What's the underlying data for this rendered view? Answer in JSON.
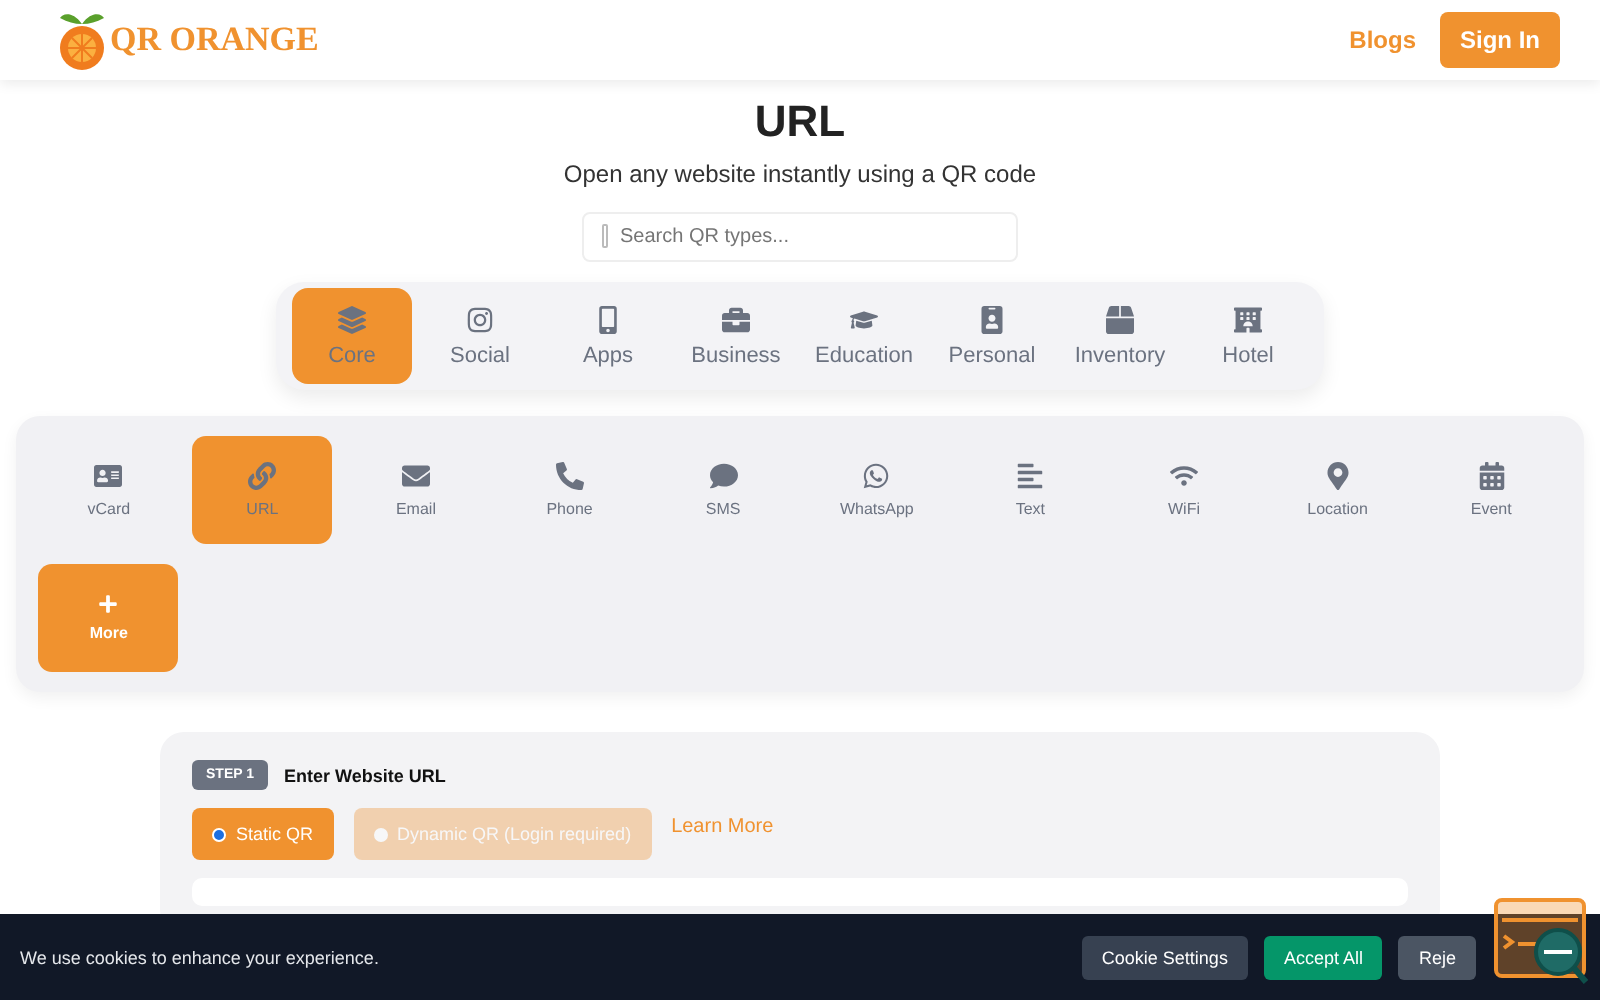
{
  "header": {
    "logo": "QR ORANGE",
    "nav": [
      {
        "label": "Blogs",
        "kind": "link"
      },
      {
        "label": "Sign In",
        "kind": "button"
      }
    ]
  },
  "title": "URL",
  "subtitle": "Open any website instantly using a QR code",
  "search": {
    "placeholder": "Search QR types..."
  },
  "categories": [
    {
      "label": "Core",
      "selected": true
    },
    {
      "label": "Social",
      "selected": false
    },
    {
      "label": "Apps",
      "selected": false
    },
    {
      "label": "Business",
      "selected": false
    },
    {
      "label": "Education",
      "selected": false
    },
    {
      "label": "Personal",
      "selected": false
    },
    {
      "label": "Inventory",
      "selected": false
    },
    {
      "label": "Hotel",
      "selected": false
    }
  ],
  "types": [
    {
      "label": "vCard",
      "kind": "type",
      "selected": false
    },
    {
      "label": "URL",
      "kind": "type",
      "selected": true
    },
    {
      "label": "Email",
      "kind": "type",
      "selected": false
    },
    {
      "label": "Phone",
      "kind": "type",
      "selected": false
    },
    {
      "label": "SMS",
      "kind": "type",
      "selected": false
    },
    {
      "label": "WhatsApp",
      "kind": "type",
      "selected": false
    },
    {
      "label": "Text",
      "kind": "type",
      "selected": false
    },
    {
      "label": "WiFi",
      "kind": "type",
      "selected": false
    },
    {
      "label": "Location",
      "kind": "type",
      "selected": false
    },
    {
      "label": "Event",
      "kind": "type",
      "selected": false
    },
    {
      "label": "More",
      "kind": "more"
    }
  ],
  "step": {
    "badge": "STEP 1",
    "title": "Enter Website URL",
    "options": [
      {
        "label": "Static QR",
        "selected": true,
        "disabled": false
      },
      {
        "label": "Dynamic QR (Login required)",
        "selected": false,
        "disabled": true
      }
    ],
    "link": "Learn More"
  },
  "cookie_bar": {
    "message": "We use cookies to enhance your experience.",
    "buttons": [
      {
        "label": "Cookie Settings",
        "kind": "settings"
      },
      {
        "label": "Accept All",
        "kind": "accept"
      },
      {
        "label": "Reje",
        "kind": "reject"
      }
    ]
  }
}
